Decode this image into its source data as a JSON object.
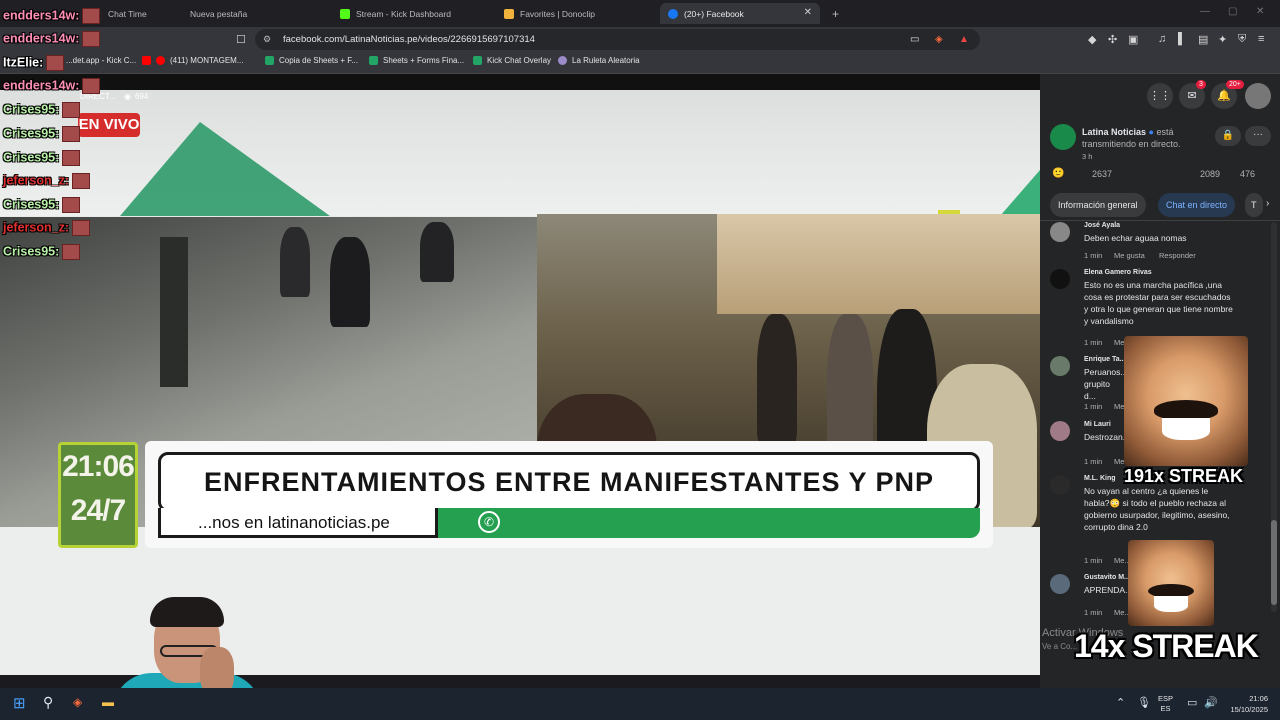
{
  "browser": {
    "tabs": [
      {
        "label": "Chat Time",
        "active": false
      },
      {
        "label": "Nueva pestaña",
        "active": false
      },
      {
        "label": "Stream - Kick Dashboard",
        "active": false
      },
      {
        "label": "Favorites | Donoclip",
        "active": false
      },
      {
        "label": "(20+) Facebook",
        "active": true
      }
    ],
    "new_tab_label": "+",
    "url": "facebook.com/LatinaNoticias.pe/videos/2266915697107314",
    "bookmarks": [
      {
        "label": "...det.app - Kick C..."
      },
      {
        "label": "(411) MONTAGEM..."
      },
      {
        "label": "Copia de Sheets + F..."
      },
      {
        "label": "Sheets + Forms Fina..."
      },
      {
        "label": "Kick Chat Overlay"
      },
      {
        "label": "La Ruleta Aleatoria"
      }
    ]
  },
  "video": {
    "live_badge": "EN VIVO",
    "direct_label": "DIRECT...",
    "viewers": "694",
    "clock_time": "21:06",
    "clock_sub": "24/7",
    "headline": "ENFRENTAMIENTOS ENTRE MANIFESTANTES Y PNP",
    "ticker": "...nos en latinanoticias.pe"
  },
  "overlay_chat": [
    {
      "user": "endders14w:",
      "color": "#ff8fb5"
    },
    {
      "user": "endders14w:",
      "color": "#ff8fb5"
    },
    {
      "user": "ItzElie:",
      "color": "#ffffff"
    },
    {
      "user": "endders14w:",
      "color": "#ff8fb5"
    },
    {
      "user": "Crises95:",
      "color": "#b8f0a8"
    },
    {
      "user": "Crises95:",
      "color": "#b8f0a8"
    },
    {
      "user": "Crises95:",
      "color": "#b8f0a8"
    },
    {
      "user": "jeferson_z:",
      "color": "#e03030"
    },
    {
      "user": "Crises95:",
      "color": "#b8f0a8"
    },
    {
      "user": "jeferson_z:",
      "color": "#e03030"
    },
    {
      "user": "Crises95:",
      "color": "#b8f0a8"
    }
  ],
  "facebook": {
    "notif_badge": "20+",
    "messenger_badge": "3",
    "page_name": "Latina Noticias",
    "status": "está transmitiendo en directo.",
    "time": "3 h",
    "reactions_count": "2637",
    "comments_count": "2089",
    "shares_count": "476",
    "tabs": [
      "Información general",
      "Chat en directo",
      "T"
    ],
    "comments": [
      {
        "name": "José Ayala",
        "text": "Deben echar aguaa nomas",
        "time": "1 min",
        "like": "Me gusta",
        "reply": "Responder"
      },
      {
        "name": "Elena Gamero Rivas",
        "text": "Esto no es una marcha pacífica ,una cosa es protestar para ser escuchados y otra lo que generan que tiene nombre y vandalismo",
        "time": "1 min",
        "like": "Me..."
      },
      {
        "name": "Enrique Ta...",
        "text": "Peruanos... grupito d...",
        "time": "1 min",
        "like": "Me..."
      },
      {
        "name": "Mi Lauri",
        "text": "Destrozan...",
        "time": "1 min",
        "like": "Me..."
      },
      {
        "name": "M.L. King",
        "text": "No vayan al centro ¿a quienes le habla?😳 si todo el pueblo rechaza al gobierno usurpador, ilegitimo, asesino, corrupto dina 2.0",
        "time": "1 min",
        "like": "Me..."
      },
      {
        "name": "Gustavito M...",
        "text": "APRENDA...",
        "time": "1 min",
        "like": "Me..."
      }
    ]
  },
  "streaks": {
    "top": "191x STREAK",
    "bottom": "14x STREAK"
  },
  "windows_watermark": {
    "line1": "Activar Windows",
    "line2": "Ve a Co..."
  },
  "taskbar": {
    "lang_top": "ESP",
    "lang_bottom": "ES",
    "time": "21:06",
    "date": "15/10/2025"
  }
}
